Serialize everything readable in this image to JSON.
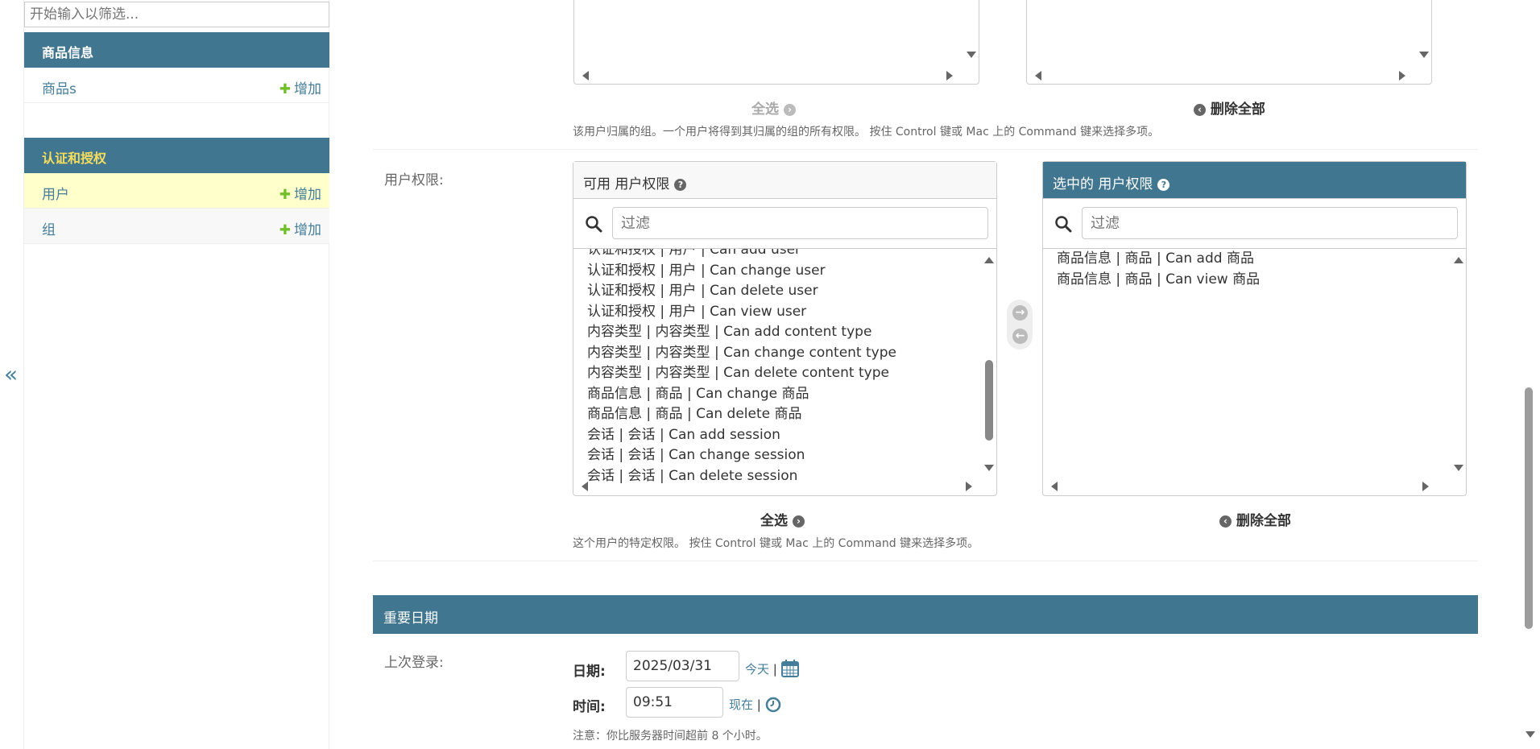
{
  "sidebar": {
    "filter_placeholder": "开始输入以筛选...",
    "apps": [
      {
        "caption": "商品信息",
        "models": [
          {
            "name": "商品s",
            "add": "增加"
          }
        ]
      },
      {
        "caption": "认证和授权",
        "models": [
          {
            "name": "用户",
            "add": "增加"
          },
          {
            "name": "组",
            "add": "增加"
          }
        ]
      }
    ],
    "toggle": "«"
  },
  "groups": {
    "choose_all": "全选",
    "remove_all": "删除全部",
    "help": "该用户归属的组。一个用户将得到其归属的组的所有权限。 按住 Control 键或 Mac 上的 Command 键来选择多项。"
  },
  "permissions": {
    "label": "用户权限:",
    "available_title": "可用 用户权限",
    "chosen_title": "选中的 用户权限",
    "filter_placeholder": "过滤",
    "available": [
      "认证和授权 | 用户 | Can add user",
      "认证和授权 | 用户 | Can change user",
      "认证和授权 | 用户 | Can delete user",
      "认证和授权 | 用户 | Can view user",
      "内容类型 | 内容类型 | Can add content type",
      "内容类型 | 内容类型 | Can change content type",
      "内容类型 | 内容类型 | Can delete content type",
      "商品信息 | 商品 | Can change 商品",
      "商品信息 | 商品 | Can delete 商品",
      "会话 | 会话 | Can add session",
      "会话 | 会话 | Can change session",
      "会话 | 会话 | Can delete session"
    ],
    "chosen": [
      "商品信息 | 商品 | Can add 商品",
      "商品信息 | 商品 | Can view 商品"
    ],
    "choose_all": "全选",
    "remove_all": "删除全部",
    "help": "这个用户的特定权限。 按住 Control 键或 Mac 上的 Command 键来选择多项。"
  },
  "important_dates": {
    "title": "重要日期",
    "last_login_label": "上次登录:",
    "date_label": "日期:",
    "date_value": "2025/03/31",
    "today": "今天",
    "time_label": "时间:",
    "time_value": "09:51",
    "now": "现在",
    "separator": "|",
    "note": "注意：你比服务器时间超前 8 个小时。"
  }
}
